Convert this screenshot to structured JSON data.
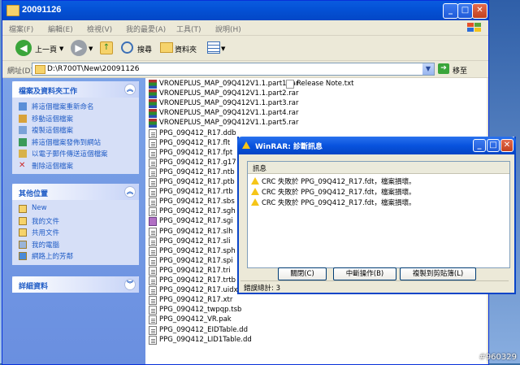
{
  "explorer": {
    "title": "20091126",
    "menu": [
      "檔案(F)",
      "編輯(E)",
      "檢視(V)",
      "我的最愛(A)",
      "工具(T)",
      "說明(H)"
    ],
    "toolbar": {
      "back": "上一頁",
      "search": "搜尋",
      "folders": "資料夾"
    },
    "address": {
      "label": "網址(D)",
      "path": "D:\\R700T\\New\\20091126",
      "go": "移至"
    },
    "tasks_panel": {
      "title": "檔案及資料夾工作",
      "items": [
        "將這個檔案重新命名",
        "移動這個檔案",
        "複製這個檔案",
        "將這個檔案發佈到網站",
        "以電子郵件傳送這個檔案",
        "刪除這個檔案"
      ]
    },
    "places_panel": {
      "title": "其他位置",
      "items": [
        "New",
        "我的文件",
        "共用文件",
        "我的電腦",
        "網路上的芳鄰"
      ]
    },
    "details_panel": {
      "title": "詳細資料"
    },
    "files_col1": [
      {
        "name": "VRONEPLUS_MAP_09Q412V1.1.part1.rar",
        "type": "rar"
      },
      {
        "name": "VRONEPLUS_MAP_09Q412V1.1.part2.rar",
        "type": "rar"
      },
      {
        "name": "VRONEPLUS_MAP_09Q412V1.1.part3.rar",
        "type": "rar"
      },
      {
        "name": "VRONEPLUS_MAP_09Q412V1.1.part4.rar",
        "type": "rar"
      },
      {
        "name": "VRONEPLUS_MAP_09Q412V1.1.part5.rar",
        "type": "rar"
      },
      {
        "name": "PPG_09Q412_R17.ddb",
        "type": "doc"
      },
      {
        "name": "PPG_09Q412_R17.flt",
        "type": "doc"
      },
      {
        "name": "PPG_09Q412_R17.fpt",
        "type": "doc"
      },
      {
        "name": "PPG_09Q412_R17.g17",
        "type": "doc"
      },
      {
        "name": "PPG_09Q412_R17.ntb",
        "type": "doc"
      },
      {
        "name": "PPG_09Q412_R17.ptb",
        "type": "doc"
      },
      {
        "name": "PPG_09Q412_R17.rtb",
        "type": "doc"
      },
      {
        "name": "PPG_09Q412_R17.sbs",
        "type": "doc"
      },
      {
        "name": "PPG_09Q412_R17.sgh",
        "type": "doc"
      },
      {
        "name": "PPG_09Q412_R17.sgi",
        "type": "sgi"
      },
      {
        "name": "PPG_09Q412_R17.slh",
        "type": "doc"
      },
      {
        "name": "PPG_09Q412_R17.sli",
        "type": "doc"
      },
      {
        "name": "PPG_09Q412_R17.sph",
        "type": "doc"
      },
      {
        "name": "PPG_09Q412_R17.spi",
        "type": "doc"
      },
      {
        "name": "PPG_09Q412_R17.tri",
        "type": "doc"
      },
      {
        "name": "PPG_09Q412_R17.trtb",
        "type": "doc"
      },
      {
        "name": "PPG_09Q412_R17.uidx",
        "type": "doc"
      },
      {
        "name": "PPG_09Q412_R17.xtr",
        "type": "doc"
      },
      {
        "name": "PPG_09Q412_twpqp.tsb",
        "type": "doc"
      },
      {
        "name": "PPG_09Q412_VR.pak",
        "type": "doc"
      },
      {
        "name": "PPG_09Q412_EIDTable.dd",
        "type": "doc"
      },
      {
        "name": "PPG_09Q412_LID1Table.dd",
        "type": "doc"
      }
    ],
    "files_col2": [
      {
        "name": "Release Note.txt",
        "type": "txt"
      }
    ]
  },
  "winrar_dialog": {
    "title": "WinRAR: 診斷訊息",
    "column_header": "訊息",
    "messages": [
      "CRC 失敗於 PPG_09Q412_R17.fdt，檔案損壞。",
      "CRC 失敗於 PPG_09Q412_R17.fdt，檔案損壞。",
      "CRC 失敗於 PPG_09Q412_R17.fdt，檔案損壞。"
    ],
    "buttons": {
      "close": "關閉(C)",
      "abort": "中斷操作(B)",
      "copy": "複製到剪貼簿(L)"
    },
    "status": "錯誤總計: 3"
  },
  "watermark": "#960329",
  "colors": {
    "titlebar": "#0452d6",
    "panel_link": "#215dc6",
    "warning": "#f5c518"
  }
}
